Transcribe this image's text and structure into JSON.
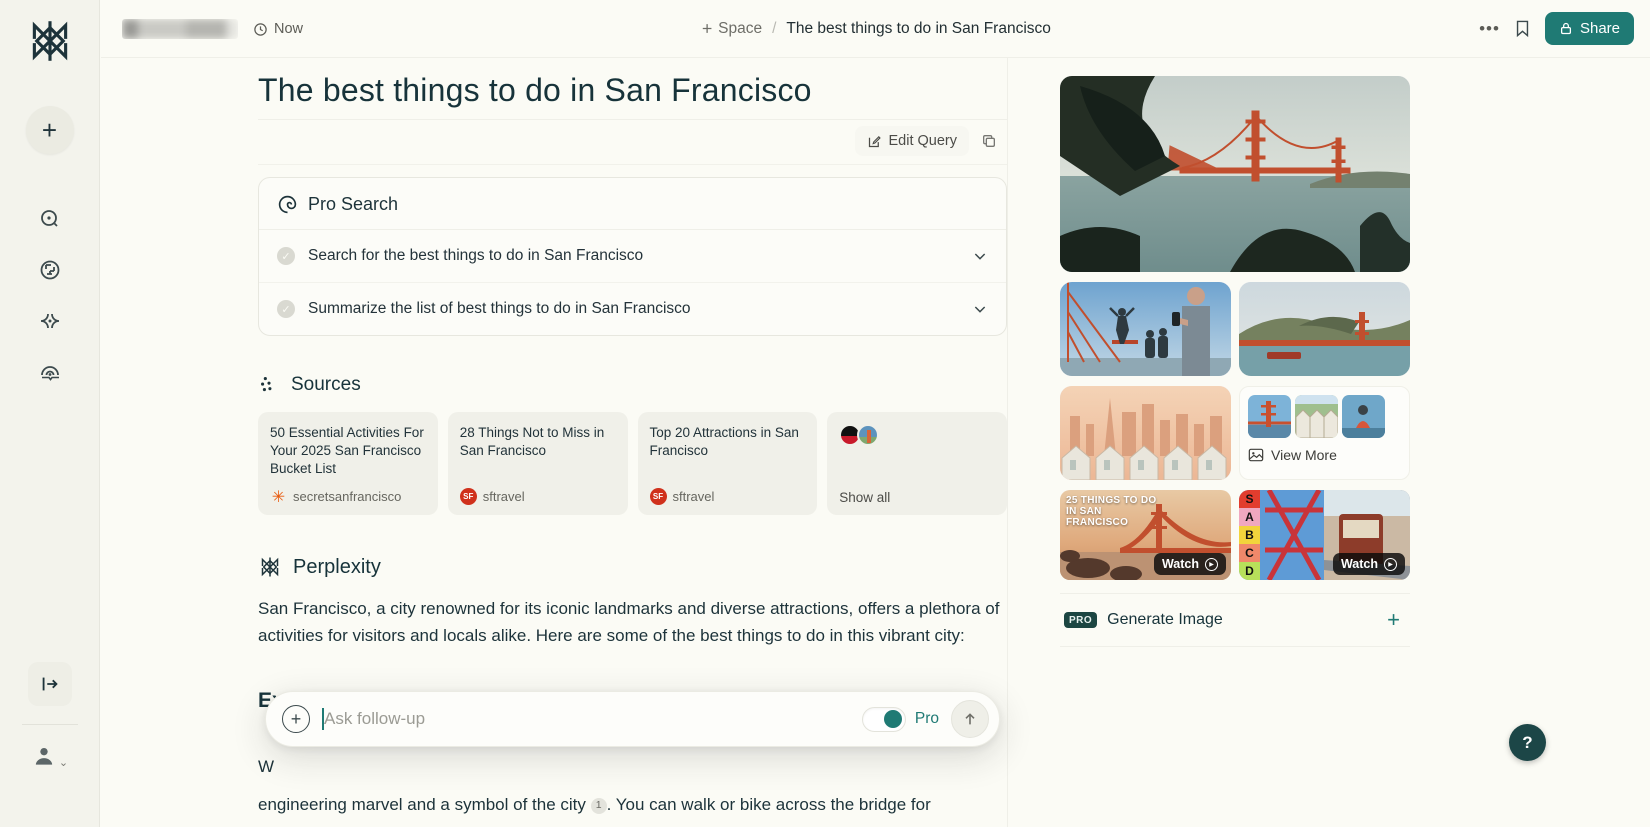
{
  "colors": {
    "accent_teal": "#1f7a74",
    "help_bg": "#1c4647",
    "favicon_orange": "#e8590c",
    "favicon_red": "#d0311c",
    "ink": "#13343b"
  },
  "sidebar": {
    "new_thread_label": "+",
    "items": [
      {
        "name": "search"
      },
      {
        "name": "discover"
      },
      {
        "name": "spaces"
      },
      {
        "name": "library"
      }
    ]
  },
  "topbar": {
    "time_label": "Now",
    "breadcrumb": {
      "space": "Space",
      "separator": "/",
      "title": "The best things to do in San Francisco"
    },
    "more_label": "...",
    "share_label": "Share"
  },
  "main": {
    "title": "The best things to do in San Francisco",
    "edit_query_label": "Edit Query",
    "pro_search": {
      "heading": "Pro Search",
      "steps": [
        {
          "label": "Search for the best things to do in San Francisco"
        },
        {
          "label": "Summarize the list of best things to do in San Francisco"
        }
      ]
    },
    "sources": {
      "heading": "Sources",
      "cards": [
        {
          "title": "50 Essential Activities For Your 2025 San Francisco Bucket List",
          "domain": "secretsanfrancisco",
          "favicon": "orange-asterisk"
        },
        {
          "title": "28 Things Not to Miss in San Francisco",
          "domain": "sftravel",
          "favicon": "sf-red-circle"
        },
        {
          "title": "Top 20 Attractions in San Francisco",
          "domain": "sftravel",
          "favicon": "sf-red-circle"
        }
      ],
      "show_all_label": "Show all"
    },
    "answer": {
      "heading": "Perplexity",
      "intro": "San Francisco, a city renowned for its iconic landmarks and diverse attractions, offers a plethora of activities for visitors and locals alike. Here are some of the best things to do in this vibrant city:",
      "section_heading": "Explore Iconic Landmarks",
      "occluded_line_start": "W",
      "bottom_text_before": "engineering marvel and a symbol of the city ",
      "citation": "1",
      "bottom_text_after": ". You can walk or bike across the bridge for"
    }
  },
  "followup": {
    "placeholder": "Ask follow-up",
    "pro_label": "Pro"
  },
  "media": {
    "view_more_label": "View More",
    "watch_label": "Watch",
    "video1_title": "25 things to do in San Francisco",
    "video2_letters": [
      "S",
      "A",
      "B",
      "C",
      "D"
    ],
    "generate": {
      "badge": "PRO",
      "label": "Generate Image",
      "plus": "+"
    }
  },
  "help_label": "?"
}
